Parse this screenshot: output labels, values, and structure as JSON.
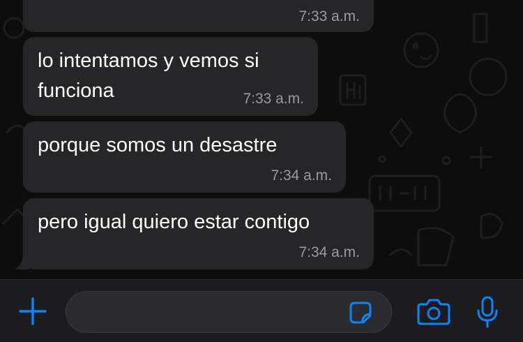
{
  "chat": {
    "messages": [
      {
        "lines": [],
        "time": "7:33 a.m."
      },
      {
        "lines": [
          "lo intentamos y vemos si",
          "funciona"
        ],
        "time": "7:33 a.m."
      },
      {
        "lines": [
          "porque somos un desastre"
        ],
        "time": "7:34 a.m."
      },
      {
        "lines": [
          "pero igual quiero estar contigo"
        ],
        "time": "7:34 a.m."
      }
    ]
  },
  "input_bar": {
    "message_value": "",
    "icons": {
      "add": "plus-icon",
      "sticker": "sticker-icon",
      "camera": "camera-icon",
      "mic": "microphone-icon"
    }
  },
  "colors": {
    "accent": "#0a84ff",
    "bubble": "#262628",
    "background": "#0b0b0b",
    "input_bar": "#1c1c1e",
    "timestamp": "#9a9a9f"
  }
}
